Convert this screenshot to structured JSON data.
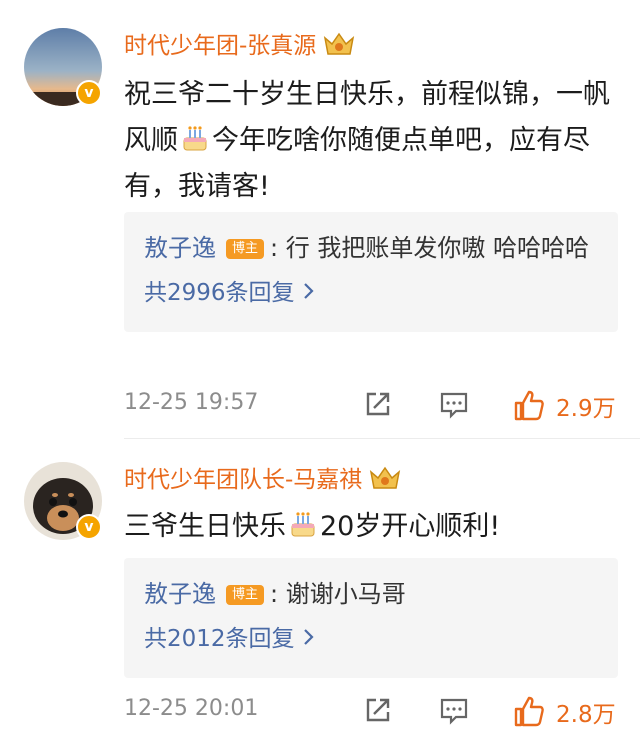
{
  "comments": [
    {
      "username": "时代少年团-张真源",
      "text_part1": "祝三爷二十岁生日快乐，前程似锦，一帆风顺",
      "text_part2": "今年吃啥你随便点单吧，应有尽有，我请客!",
      "reply_author": "敖子逸",
      "host_label": "博主",
      "reply_text": ": 行 我把账单发你嗷 哈哈哈哈",
      "reply_count_label": "共2996条回复",
      "time": "12-25 19:57",
      "likes": "2.9万"
    },
    {
      "username": "时代少年团队长-马嘉祺",
      "text_part1": "三爷生日快乐",
      "text_part2": "20岁开心顺利!",
      "reply_author": "敖子逸",
      "host_label": "博主",
      "reply_text": ": 谢谢小马哥",
      "reply_count_label": "共2012条回复",
      "time": "12-25 20:01",
      "likes": "2.8万"
    }
  ],
  "icons": {
    "verified": "verified-badge-icon",
    "crown": "crown-icon",
    "cake": "birthday-cake-icon",
    "share": "share-icon",
    "comment": "comment-icon",
    "like": "thumbs-up-icon",
    "chevron": "chevron-right-icon"
  },
  "colors": {
    "username": "#e86a1c",
    "reply_author": "#4a6aa5",
    "host_badge": "#f59a23",
    "like": "#e86a1c",
    "verified": "#f5a400"
  }
}
